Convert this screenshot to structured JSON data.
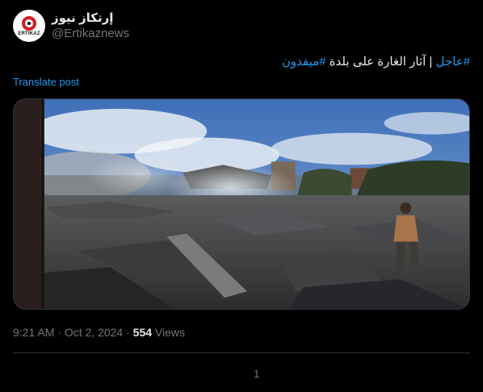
{
  "author": {
    "display_name": "إرتكاز نيوز",
    "handle": "@Ertikaznews",
    "avatar_brand": "ERTIKAZ"
  },
  "post": {
    "hashtag_1": "#عاجل",
    "separator": " | ",
    "body": "آثار الغارة على بلدة ",
    "hashtag_2": "#ميفدون",
    "translate_label": "Translate post"
  },
  "meta": {
    "time": "9:21 AM",
    "dot1": " · ",
    "date": "Oct 2, 2024",
    "dot2": " · ",
    "views_count": "554",
    "views_label": " Views"
  },
  "actions": {
    "reply_count": "1"
  },
  "colors": {
    "background": "#000000",
    "text": "#e7e9ea",
    "muted": "#71767b",
    "link": "#1d9bf0",
    "divider": "#2f3336"
  }
}
